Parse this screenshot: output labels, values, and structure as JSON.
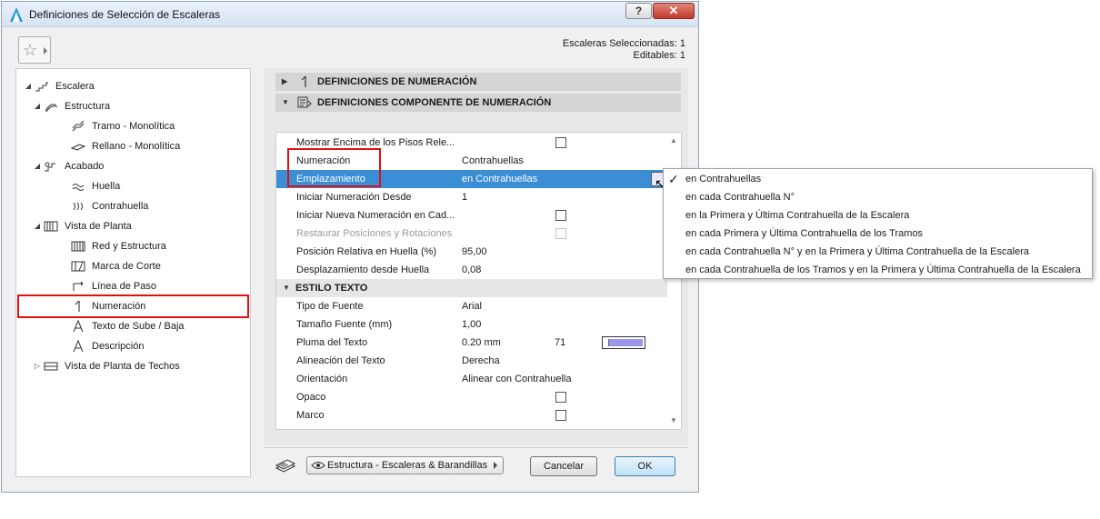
{
  "window": {
    "title": "Definiciones de Selección de Escaleras",
    "help": "?",
    "close": "✕"
  },
  "selection_info": {
    "line1": "Escaleras Seleccionadas: 1",
    "line2": "Editables: 1"
  },
  "tree": [
    {
      "label": "Escalera",
      "icon": "stair-icon",
      "expander": "◢"
    },
    {
      "label": "Estructura",
      "icon": "structure-icon",
      "expander": "◢"
    },
    {
      "label": "Tramo - Monolítica",
      "icon": "flight-icon",
      "expander": ""
    },
    {
      "label": "Rellano - Monolítica",
      "icon": "landing-icon",
      "expander": ""
    },
    {
      "label": "Acabado",
      "icon": "finish-icon",
      "expander": "◢"
    },
    {
      "label": "Huella",
      "icon": "tread-icon",
      "expander": ""
    },
    {
      "label": "Contrahuella",
      "icon": "riser-icon",
      "expander": ""
    },
    {
      "label": "Vista de Planta",
      "icon": "floor-plan-icon",
      "expander": "◢"
    },
    {
      "label": "Red y Estructura",
      "icon": "grid-structure-icon",
      "expander": ""
    },
    {
      "label": "Marca de Corte",
      "icon": "break-mark-icon",
      "expander": ""
    },
    {
      "label": "Línea de Paso",
      "icon": "walking-line-icon",
      "expander": ""
    },
    {
      "label": "Numeración",
      "icon": "numbering-icon",
      "expander": ""
    },
    {
      "label": "Texto de Sube / Baja",
      "icon": "text-a-icon",
      "expander": ""
    },
    {
      "label": "Descripción",
      "icon": "text-a-icon",
      "expander": ""
    },
    {
      "label": "Vista de Planta de Techos",
      "icon": "ceiling-plan-icon",
      "expander": "▷"
    }
  ],
  "sections": {
    "numbering": {
      "label": "DEFINICIONES DE NUMERACIÓN",
      "tri": "▶"
    },
    "numbering_component": {
      "label": "DEFINICIONES COMPONENTE DE NUMERACIÓN",
      "tri": "▼"
    }
  },
  "properties": [
    {
      "label": "Mostrar Encima de los Pisos Rele...",
      "value": "",
      "checkbox": true
    },
    {
      "label": "Numeración",
      "value": "Contrahuellas"
    },
    {
      "label": "Emplazamiento",
      "value": "en Contrahuellas",
      "selected": true
    },
    {
      "label": "Iniciar Numeración Desde",
      "value": "1"
    },
    {
      "label": "Iniciar Nueva Numeración en Cad...",
      "value": "",
      "checkbox": true
    },
    {
      "label": "Restaurar Posiciones y Rotaciones",
      "value": "",
      "checkbox": true,
      "disabled": true
    },
    {
      "label": "Posición Relativa en Huella (%)",
      "value": "95,00"
    },
    {
      "label": "Desplazamiento desde Huella",
      "value": "0,08"
    },
    {
      "label": "ESTILO TEXTO",
      "group": true,
      "tri": "▼"
    },
    {
      "label": "Tipo de Fuente",
      "value": "Arial"
    },
    {
      "label": "Tamaño Fuente (mm)",
      "value": "1,00"
    },
    {
      "label": "Pluma del Texto",
      "value": "0.20 mm",
      "pen": "71",
      "pen_color": "#9b97e8"
    },
    {
      "label": "Alineación del Texto",
      "value": "Derecha"
    },
    {
      "label": "Orientación",
      "value": "Alinear con Contrahuella"
    },
    {
      "label": "Opaco",
      "value": "",
      "checkbox": true
    },
    {
      "label": "Marco",
      "value": "",
      "checkbox": true
    }
  ],
  "dropdown": {
    "check": "✓",
    "options": [
      "en Contrahuellas",
      "en cada Contrahuella N°",
      "en la Primera y Última Contrahuella de la Escalera",
      "en cada Primera y Última Contrahuella de los Tramos",
      "en cada Contrahuella N° y en la Primera y Última Contrahuella de la Escalera",
      "en cada Contrahuella de los Tramos y en la Primera y Última Contrahuella de la Escalera"
    ]
  },
  "footer": {
    "layer": "Estructura - Escaleras & Barandillas",
    "cancel": "Cancelar",
    "ok": "OK"
  },
  "colors": {
    "selection": "#3b8ed6",
    "highlight": "#e01010",
    "accent": "#1f9bd7"
  }
}
